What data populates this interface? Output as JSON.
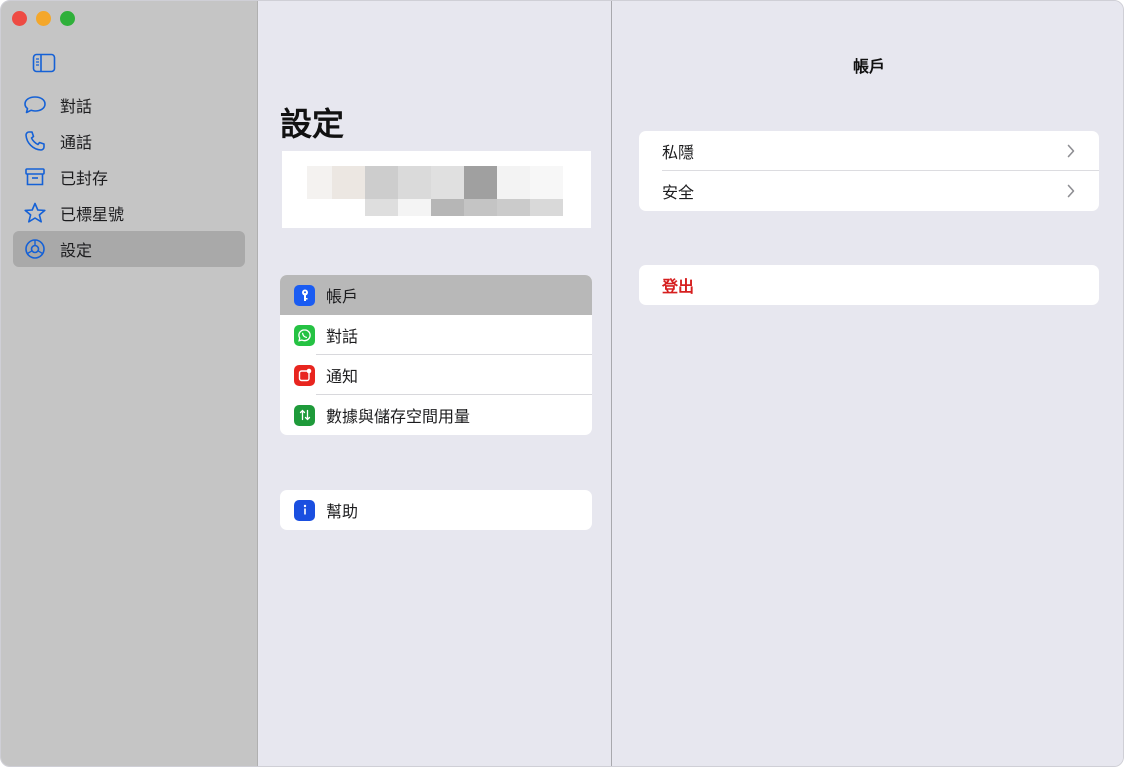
{
  "sidebar": {
    "items": [
      {
        "label": "對話",
        "icon": "chat-bubble-icon"
      },
      {
        "label": "通話",
        "icon": "phone-icon"
      },
      {
        "label": "已封存",
        "icon": "archive-icon"
      },
      {
        "label": "已標星號",
        "icon": "star-icon"
      },
      {
        "label": "設定",
        "icon": "gear-icon"
      }
    ],
    "active_index": 4
  },
  "settings": {
    "title": "設定",
    "groups": [
      [
        {
          "label": "帳戶",
          "icon": "key-icon",
          "color": "#1a5cf2"
        },
        {
          "label": "對話",
          "icon": "whatsapp-icon",
          "color": "#25c243"
        },
        {
          "label": "通知",
          "icon": "notification-icon",
          "color": "#e8251f"
        },
        {
          "label": "數據與儲存空間用量",
          "icon": "data-arrows-icon",
          "color": "#1e9a3a"
        }
      ],
      [
        {
          "label": "幫助",
          "icon": "info-icon",
          "color": "#1a4fe0"
        }
      ]
    ]
  },
  "detail": {
    "title": "帳戶",
    "rows": [
      {
        "label": "私隱"
      },
      {
        "label": "安全"
      }
    ],
    "logout_label": "登出"
  },
  "colors": {
    "logout": "#d61f1f",
    "selected_row": "#b8b8b8",
    "sidebar_bg": "#c5c5c5"
  }
}
